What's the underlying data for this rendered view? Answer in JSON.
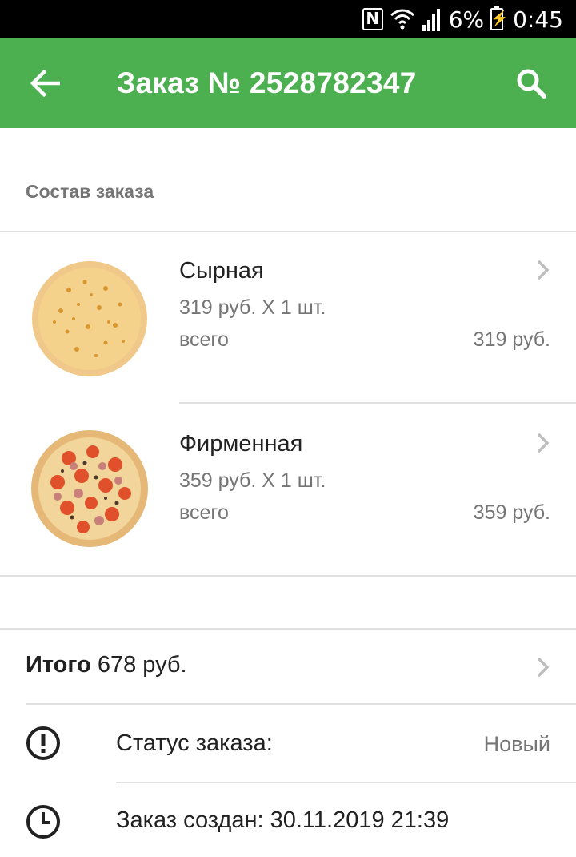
{
  "status_bar": {
    "battery": "6%",
    "time": "0:45",
    "icons": [
      "nfc-icon",
      "wifi-icon",
      "signal-icon",
      "battery-charging-icon"
    ]
  },
  "toolbar": {
    "title": "Заказ № 2528782347",
    "back_icon": "arrow-back-icon",
    "search_icon": "search-icon",
    "background": "#4caf50"
  },
  "order": {
    "section_title": "Состав заказа",
    "items": [
      {
        "name": "Сырная",
        "qty_line": "319 руб. X 1 шт.",
        "total_label": "всего",
        "total_value": "319 руб.",
        "image": "cheese-pizza-image"
      },
      {
        "name": "Фирменная",
        "qty_line": "359 руб. X 1 шт.",
        "total_label": "всего",
        "total_value": "359 руб.",
        "image": "signature-pizza-image"
      }
    ]
  },
  "summary": {
    "total_label": "Итого",
    "total_value": "678 руб.",
    "status_label": "Статус заказа:",
    "status_value": "Новый",
    "status_icon": "alert-circle-icon",
    "created_text": "Заказ создан: 30.11.2019 21:39",
    "created_icon": "clock-icon"
  }
}
